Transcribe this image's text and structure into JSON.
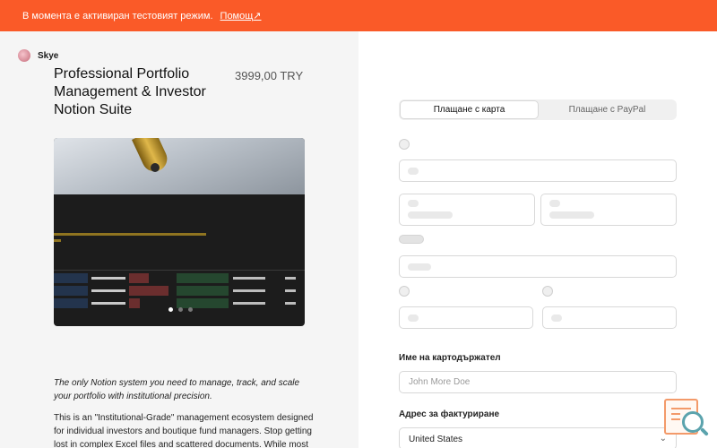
{
  "banner": {
    "message": "В момента е активиран тестовият режим.",
    "help_label": "Помощ",
    "help_icon": "external-link-icon"
  },
  "seller": {
    "name": "Skye"
  },
  "product": {
    "title": "Professional Portfolio Management & Investor Notion Suite",
    "price": "3999,00 TRY",
    "image_dots": 3,
    "image_active_dot": 1
  },
  "description": {
    "lead": "The only Notion system you need to manage, track, and scale your portfolio with institutional precision.",
    "body": "This is an \"Institutional-Grade\" management ecosystem designed for individual investors and boutique fund managers. Stop getting lost in complex Excel files and scattered documents. While most"
  },
  "payment": {
    "tabs": [
      {
        "label": "Плащане с карта",
        "active": true
      },
      {
        "label": "Плащане с PayPal",
        "active": false
      }
    ]
  },
  "form": {
    "cardholder_label": "Име на картодържател",
    "cardholder_placeholder": "John More Doe",
    "billing_label": "Адрес за фактуриране",
    "country_value": "United States"
  },
  "colors": {
    "banner": "#fa5a28",
    "left_panel": "#f5f5f5"
  }
}
